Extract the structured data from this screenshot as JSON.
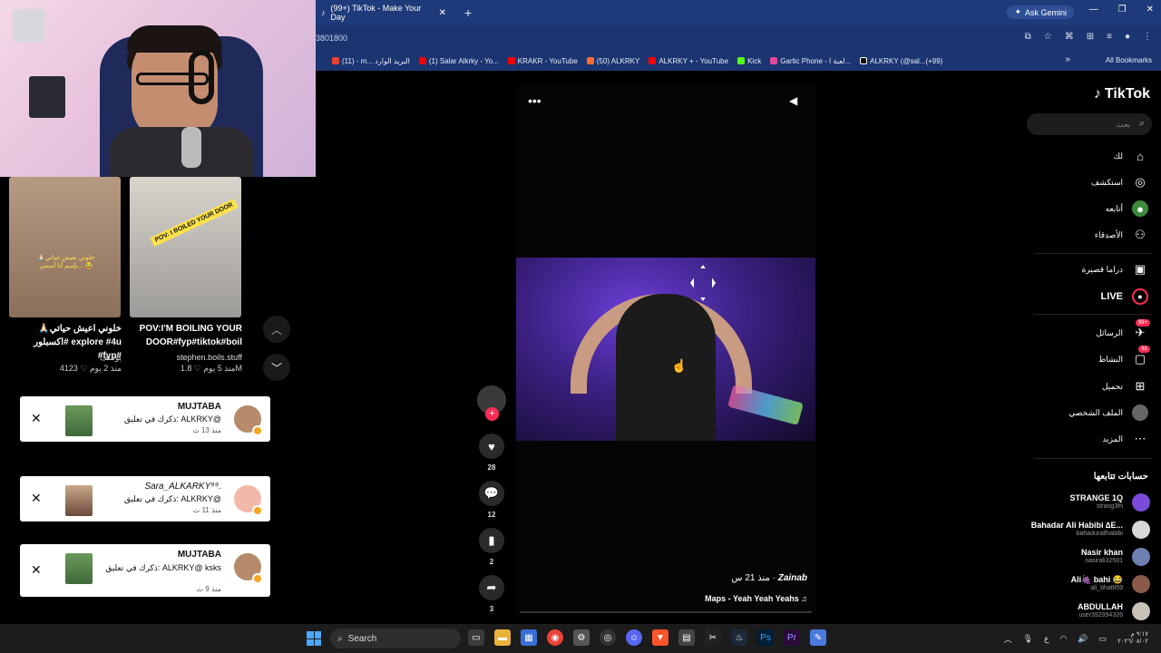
{
  "browser": {
    "tab_title": "(99+) TikTok - Make Your Day",
    "gemini_label": "Ask Gemini",
    "url_fragment": "3801800",
    "bookmarks": [
      {
        "label": "(11) - m... البريد الوارد",
        "color": "#ea4335"
      },
      {
        "label": "(1) Salar Alkrky - Yo...",
        "color": "#ff0000"
      },
      {
        "label": "KRAKR - YouTube",
        "color": "#ff0000"
      },
      {
        "label": "(50) ALKRKY",
        "color": "#ff6b35"
      },
      {
        "label": "ALKRKY + - YouTube",
        "color": "#ff0000"
      },
      {
        "label": "Kick",
        "color": "#53fc18"
      },
      {
        "label": "Gartic Phone - لعبة ا...",
        "color": "#e24a9a"
      },
      {
        "label": "ALKRKY (@sal...(+99)",
        "color": "#111111"
      }
    ],
    "all_bookmarks": "All Bookmarks"
  },
  "left": {
    "videos": [
      {
        "caption": "خلوني اعيش حياتي🙏🏻 #اكسبلور explore #4u #fyp#",
        "author": "يوسف",
        "likes": "4123",
        "age": "منذ 2 يوم",
        "overlay": "خلوني نعيش حياتي🙏🏻 بإسم أنا أسمي... 😂"
      },
      {
        "caption": "POV:I'M BOILING YOUR DOOR#fyp#tiktok#boil",
        "author": "stephen.boils.stuff",
        "likes": "1.8M",
        "age": "منذ 5 يوم",
        "sticker": "POV: I BOILED YOUR DOOR"
      }
    ],
    "notifications": [
      {
        "name": "MUJTABA",
        "line": "ذكرك في تعليق: ALKRKY@",
        "time": "منذ 13 ث"
      },
      {
        "name": "Sara_ALKARKY⁹⁹.",
        "line": "ذكرك في تعليق: ALKRKY@",
        "time": "منذ 11 ث"
      },
      {
        "name": "MUJTABA",
        "line": "ذكرك في تعليق: ALKRKY@ ksks",
        "time": "منذ 9 ث"
      }
    ]
  },
  "video": {
    "author": "Zainab",
    "age": "منذ 21 س",
    "song": "Maps - Yeah Yeah Yeahs",
    "progress": 0.0,
    "likes": "28",
    "comments": "12",
    "saves": "2",
    "shares": "3"
  },
  "sidebar": {
    "logo": "TikTok",
    "search_placeholder": "بحث",
    "nav": [
      {
        "label": "لك",
        "icon": "home-icon"
      },
      {
        "label": "استكشف",
        "icon": "compass-icon"
      },
      {
        "label": "أتابعه",
        "icon": "following-icon"
      },
      {
        "label": "الأصدقاء",
        "icon": "friends-icon"
      },
      {
        "label": "دراما قصيرة",
        "icon": "drama-icon"
      },
      {
        "label": "LIVE",
        "icon": "live-icon"
      },
      {
        "label": "الرسائل",
        "icon": "messages-icon",
        "badge": "99+"
      },
      {
        "label": "النشاط",
        "icon": "activity-icon",
        "badge": "91"
      },
      {
        "label": "تحميل",
        "icon": "upload-icon"
      },
      {
        "label": "الملف الشخصي",
        "icon": "profile-icon"
      },
      {
        "label": "المزيد",
        "icon": "more-icon"
      }
    ],
    "following_title": "حسابات تتابعها",
    "accounts": [
      {
        "name": "STRANGE 1Q",
        "handle": "strang3fn",
        "color": "#7a4ad8"
      },
      {
        "name": "Bahadar Ali Habibi ∆E...",
        "handle": "bahadurallhabibi",
        "color": "#d8d8d8"
      },
      {
        "name": "Nasir khan",
        "handle": "nasirali32501",
        "color": "#6f7fb0"
      },
      {
        "name": "Ali🍇 bahi 😂",
        "handle": "ali_bhatti59",
        "color": "#8a5a4a"
      },
      {
        "name": "ABDULLAH",
        "handle": "user392994326",
        "color": "#c9c2b8"
      }
    ]
  },
  "taskbar": {
    "search_label": "Search",
    "clock_time": "٩:١٧ م",
    "clock_date": "٢٠٢٦/٠٨/٠٢",
    "lang": "ع"
  }
}
